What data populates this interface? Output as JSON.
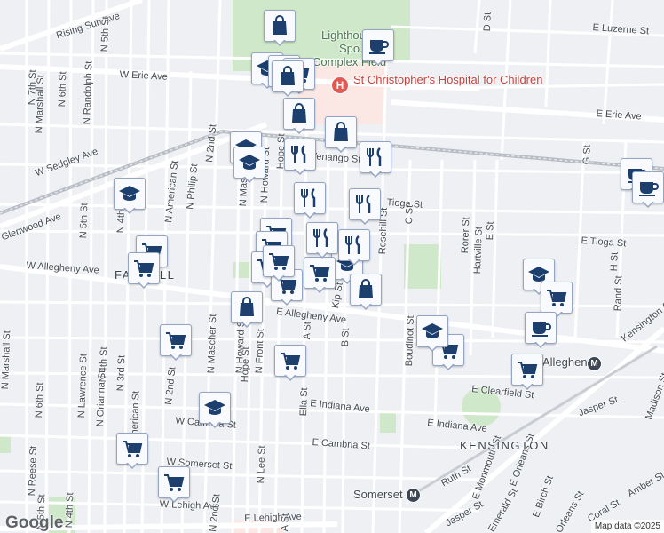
{
  "map": {
    "brand": "Google",
    "attribution": "Map data ©2025",
    "poi": {
      "hospital_label": "St Christopher's Hospital for Children",
      "hospital_glyph": "H",
      "park_label_1": "Lighthouse",
      "park_label_2": "Spo...",
      "park_label_3": "Complex Field"
    },
    "neighborhoods": [
      "FAIRHILL",
      "KENSINGTON"
    ],
    "stations": [
      "Allegheny",
      "Somerset"
    ],
    "station_glyph": "M",
    "streets": [
      "Rising Sun Ave",
      "N 5th St",
      "W Erie Ave",
      "N 7th St",
      "N 6th St",
      "N Randolph St",
      "N Marshall St",
      "W Sedgley Ave",
      "Glenwood Ave",
      "N 5th St",
      "N 4th St",
      "N American St",
      "N Philip St",
      "N 2nd St",
      "N Mascher St",
      "N Howard St",
      "Hope St",
      "E Luzerne St",
      "D St",
      "E Erie Ave",
      "G St",
      "Venango St",
      "Tioga St",
      "E Tioga St",
      "C St",
      "Rosehill St",
      "Rorer St",
      "E St",
      "Hartville St",
      "H St",
      "W Allegheny Ave",
      "E Allegheny Ave",
      "Kip St",
      "B St",
      "A St",
      "Boudinot St",
      "Rand St",
      "Kensington Ave",
      "E Clearfield St",
      "N Marshall St",
      "N 6th St",
      "N Lawrence St",
      "N 4th St",
      "N 3rd St",
      "N Orianna St",
      "N American St",
      "N 2nd St",
      "N Mascher St",
      "N Howard St",
      "Hope St",
      "N Front St",
      "Ella St",
      "E Indiana Ave",
      "E Indiana Ave",
      "Jasper St",
      "Madison St",
      "W Cambria St",
      "E Cambria St",
      "W Somerset St",
      "N Reese St",
      "N Lee St",
      "W Lehigh Ave",
      "E Lehigh Ave",
      "Ruth St",
      "E Monmouth St",
      "E Orleans St",
      "E Birch St",
      "Jasper St",
      "Coral St",
      "Amber St",
      "N 4th St",
      "N 5th St",
      "Emerald St",
      "Orleans St",
      "A St",
      "N 2nd St"
    ],
    "markers": [
      "shopping-bag",
      "coffee",
      "school",
      "shopping-bag",
      "shopping-cart",
      "shopping-bag",
      "shopping-bag",
      "school",
      "school",
      "restaurant",
      "restaurant",
      "restaurant",
      "restaurant",
      "shopping-bag",
      "school",
      "shopping-cart",
      "shopping-cart",
      "shopping-cart",
      "school",
      "shopping-bag",
      "shopping-cart",
      "shopping-cart",
      "coffee",
      "shopping-cart",
      "school",
      "shopping-cart",
      "shopping-cart",
      "school",
      "shopping-cart",
      "shopping-cart",
      "coffee",
      "coffee"
    ],
    "colors": {
      "background": "#eef0f4",
      "road": "#ffffff",
      "major_road": "#ffffff",
      "rail": "#b8bcc4",
      "park": "#cfe8c9",
      "hospital_area": "#fbe7e4",
      "pin_fill": "#f8fafd",
      "pin_border": "#93a4c4",
      "icon": "#1c3f6e"
    }
  }
}
